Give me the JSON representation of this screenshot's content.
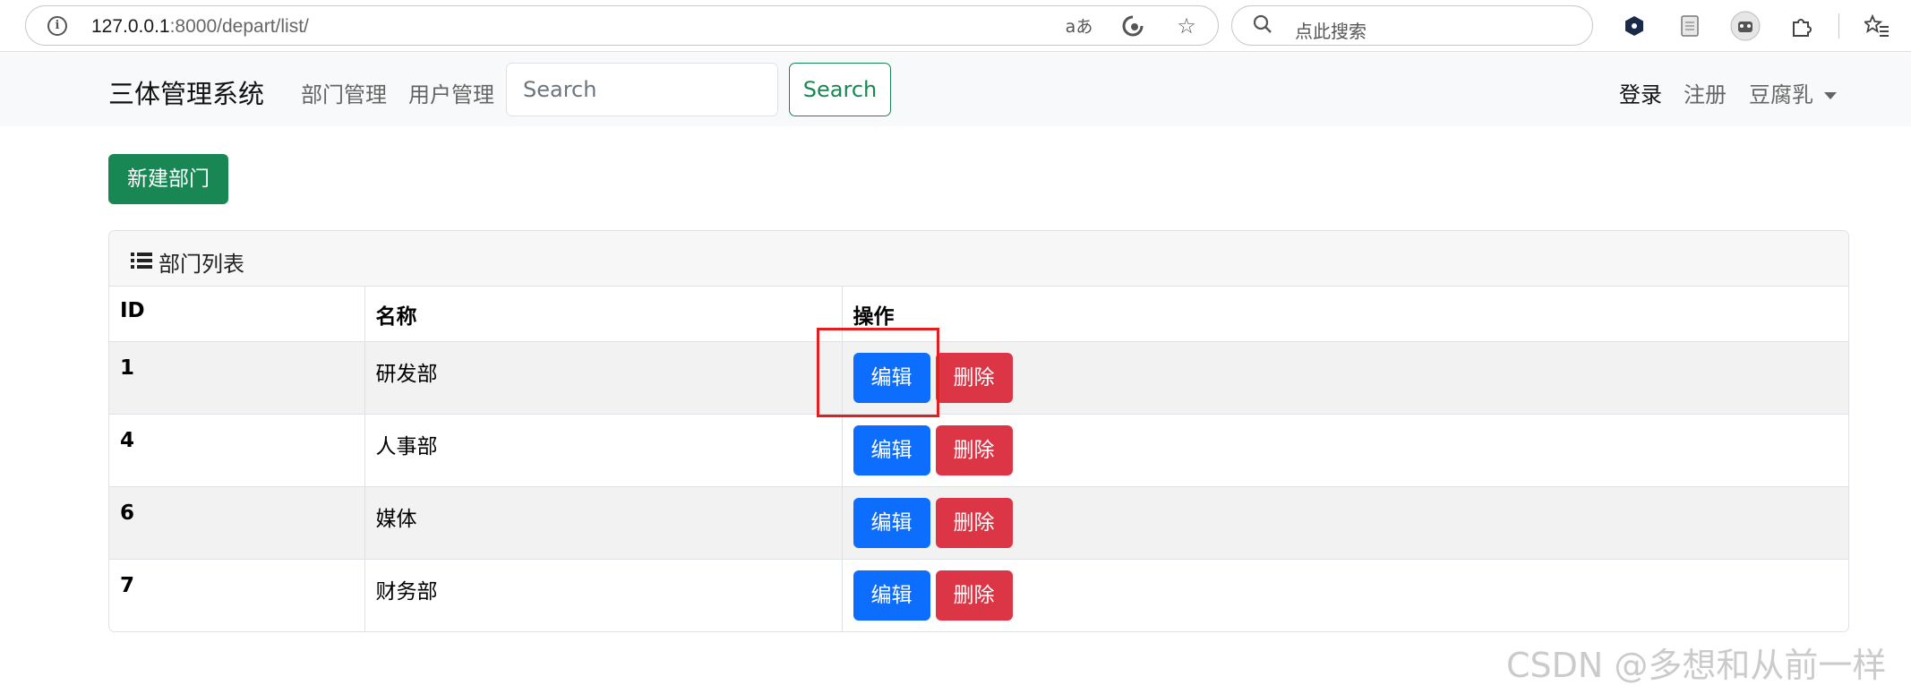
{
  "browser": {
    "url_host": "127.0.0.1",
    "url_rest": ":8000/depart/list/",
    "search_placeholder": "点此搜索",
    "read_aloud_label": "aあ"
  },
  "navbar": {
    "brand": "三体管理系统",
    "links": [
      "部门管理",
      "用户管理"
    ],
    "search_placeholder": "Search",
    "search_button": "Search",
    "login": "登录",
    "register": "注册",
    "user": "豆腐乳"
  },
  "toolbar": {
    "new_button": "新建部门"
  },
  "panel": {
    "title": "部门列表"
  },
  "table": {
    "headers": [
      "ID",
      "名称",
      "操作"
    ],
    "rows": [
      {
        "id": "1",
        "name": "研发部"
      },
      {
        "id": "4",
        "name": "人事部"
      },
      {
        "id": "6",
        "name": "媒体"
      },
      {
        "id": "7",
        "name": "财务部"
      }
    ],
    "edit_label": "编辑",
    "delete_label": "删除"
  },
  "watermark": "CSDN @多想和从前一样",
  "colors": {
    "success": "#198754",
    "primary": "#0d6efd",
    "danger": "#dc3545",
    "highlight": "#e02020"
  }
}
